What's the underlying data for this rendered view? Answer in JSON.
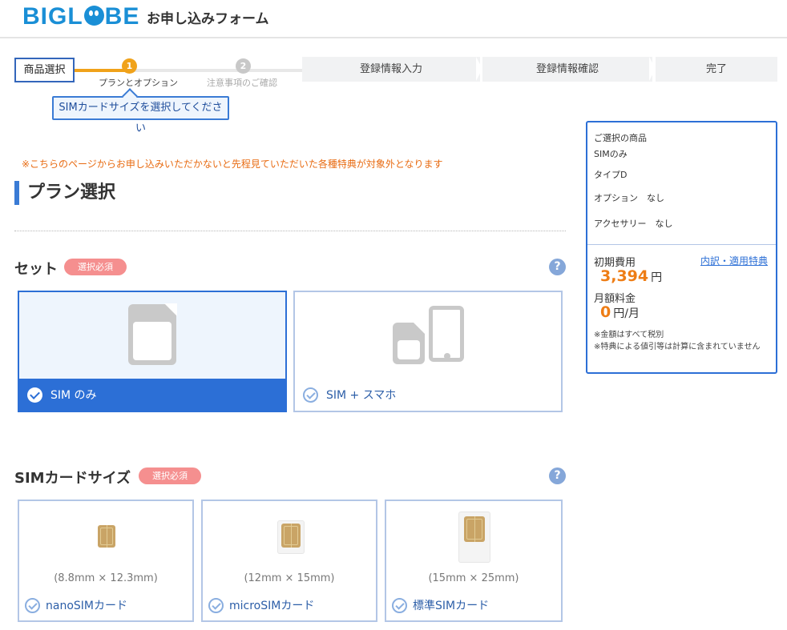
{
  "header": {
    "logo_text": "BIGLOBE",
    "title": "お申し込みフォーム"
  },
  "steps": {
    "current": "商品選択",
    "substeps": [
      {
        "num": "1",
        "label": "プランとオプション"
      },
      {
        "num": "2",
        "label": "注意事項のご確認"
      }
    ],
    "next": [
      "登録情報入力",
      "登録情報確認",
      "完了"
    ],
    "tooltip": "SIMカードサイズを選択してください"
  },
  "notice": "※こちらのページからお申し込みいただかないと先程見ていただいた各種特典が対象外となります",
  "page_title": "プラン選択",
  "set_section": {
    "title": "セット",
    "badge": "選択必須",
    "help": "?",
    "options": [
      {
        "label": "SIM のみ",
        "selected": true,
        "icon": "sim-card-icon"
      },
      {
        "label": "SIM + スマホ",
        "selected": false,
        "icon": "sim-and-phone-icon"
      }
    ]
  },
  "size_section": {
    "title": "SIMカードサイズ",
    "badge": "選択必須",
    "help": "?",
    "options": [
      {
        "dims": "(8.8mm × 12.3mm)",
        "label": "nanoSIMカード",
        "icon": "nano-sim-icon"
      },
      {
        "dims": "(12mm × 15mm)",
        "label": "microSIMカード",
        "icon": "micro-sim-icon"
      },
      {
        "dims": "(15mm × 25mm)",
        "label": "標準SIMカード",
        "icon": "standard-sim-icon"
      }
    ]
  },
  "summary": {
    "heading": "ご選択の商品",
    "product": "SIMのみ",
    "type": "タイプD",
    "option": "オプション　なし",
    "accessory": "アクセサリー　なし",
    "initial_label": "初期費用",
    "detail_link": "内訳・適用特典",
    "initial_amount": "3,394",
    "initial_unit": "円",
    "monthly_label": "月額料金",
    "monthly_amount": "0",
    "monthly_unit": "円/月",
    "note1": "※金額はすべて税別",
    "note2": "※特典による値引等は計算に含まれていません"
  },
  "colors": {
    "brand": "#1a8fd6",
    "accent": "#2c6fd6",
    "badge": "#f58f8f",
    "price": "#ee7d15"
  }
}
